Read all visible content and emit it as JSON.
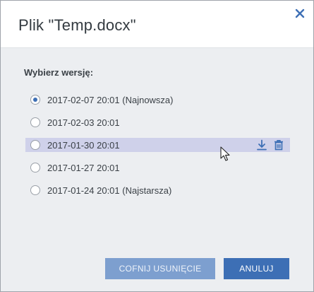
{
  "dialog": {
    "title": "Plik \"Temp.docx\"",
    "close_icon": "close-icon"
  },
  "section_label": "Wybierz wersję:",
  "versions": [
    {
      "label": "2017-02-07 20:01 (Najnowsza)",
      "checked": true
    },
    {
      "label": "2017-02-03 20:01",
      "checked": false
    },
    {
      "label": "2017-01-30 20:01",
      "checked": false,
      "hovered": true
    },
    {
      "label": "2017-01-27 20:01",
      "checked": false
    },
    {
      "label": "2017-01-24 20:01 (Najstarsza)",
      "checked": false
    }
  ],
  "row_actions": {
    "download_icon": "download-icon",
    "delete_icon": "trash-icon"
  },
  "buttons": {
    "restore_label": "COFNIJ USUNIĘCIE",
    "cancel_label": "ANULUJ"
  },
  "colors": {
    "accent": "#3d6fb5",
    "accent_disabled": "#7d9fcf",
    "hover_row": "#cfd1ea",
    "panel_bg": "#eceef1"
  }
}
